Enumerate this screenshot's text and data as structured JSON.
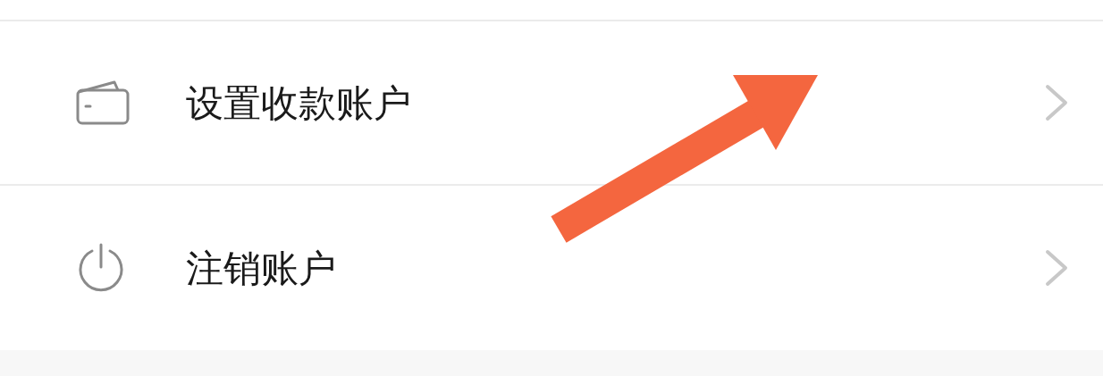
{
  "menu_items": [
    {
      "kind": "wallet",
      "label": "设置收款账户"
    },
    {
      "kind": "power",
      "label": "注销账户"
    }
  ]
}
